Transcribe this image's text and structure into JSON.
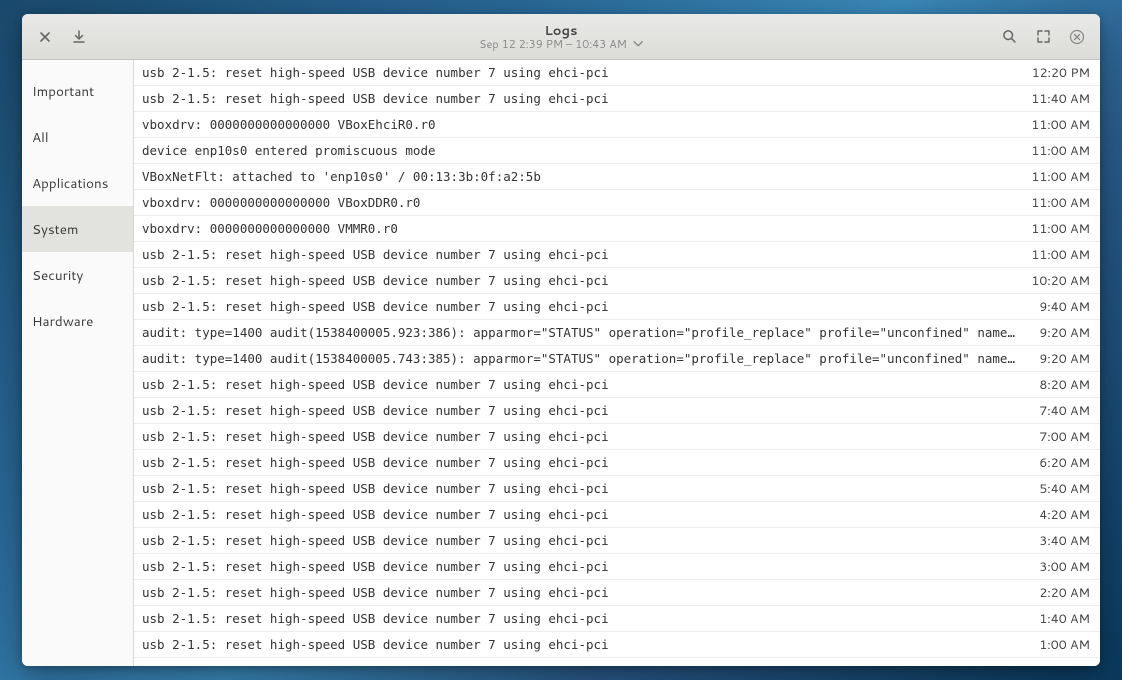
{
  "header": {
    "title": "Logs",
    "subtitle": "Sep 12  2:39 PM – 10:43 AM"
  },
  "sidebar": {
    "items": [
      {
        "label": "Important"
      },
      {
        "label": "All"
      },
      {
        "label": "Applications"
      },
      {
        "label": "System"
      },
      {
        "label": "Security"
      },
      {
        "label": "Hardware"
      }
    ],
    "active_index": 3
  },
  "logs": [
    {
      "msg": "usb 2-1.5: reset high-speed USB device number 7 using ehci-pci",
      "time": "12:20 PM"
    },
    {
      "msg": "usb 2-1.5: reset high-speed USB device number 7 using ehci-pci",
      "time": "11:40 AM"
    },
    {
      "msg": "vboxdrv: 0000000000000000 VBoxEhciR0.r0",
      "time": "11:00 AM"
    },
    {
      "msg": "device enp10s0 entered promiscuous mode",
      "time": "11:00 AM"
    },
    {
      "msg": "VBoxNetFlt: attached to 'enp10s0' / 00:13:3b:0f:a2:5b",
      "time": "11:00 AM"
    },
    {
      "msg": "vboxdrv: 0000000000000000 VBoxDDR0.r0",
      "time": "11:00 AM"
    },
    {
      "msg": "vboxdrv: 0000000000000000 VMMR0.r0",
      "time": "11:00 AM"
    },
    {
      "msg": "usb 2-1.5: reset high-speed USB device number 7 using ehci-pci",
      "time": "11:00 AM"
    },
    {
      "msg": "usb 2-1.5: reset high-speed USB device number 7 using ehci-pci",
      "time": "10:20 AM"
    },
    {
      "msg": "usb 2-1.5: reset high-speed USB device number 7 using ehci-pci",
      "time": "9:40 AM"
    },
    {
      "msg": "audit: type=1400 audit(1538400005.923:386): apparmor=\"STATUS\" operation=\"profile_replace\" profile=\"unconfined\" name=\"...\"",
      "time": "9:20 AM"
    },
    {
      "msg": "audit: type=1400 audit(1538400005.743:385): apparmor=\"STATUS\" operation=\"profile_replace\" profile=\"unconfined\" name=\"...\"",
      "time": "9:20 AM"
    },
    {
      "msg": "usb 2-1.5: reset high-speed USB device number 7 using ehci-pci",
      "time": "8:20 AM"
    },
    {
      "msg": "usb 2-1.5: reset high-speed USB device number 7 using ehci-pci",
      "time": "7:40 AM"
    },
    {
      "msg": "usb 2-1.5: reset high-speed USB device number 7 using ehci-pci",
      "time": "7:00 AM"
    },
    {
      "msg": "usb 2-1.5: reset high-speed USB device number 7 using ehci-pci",
      "time": "6:20 AM"
    },
    {
      "msg": "usb 2-1.5: reset high-speed USB device number 7 using ehci-pci",
      "time": "5:40 AM"
    },
    {
      "msg": "usb 2-1.5: reset high-speed USB device number 7 using ehci-pci",
      "time": "4:20 AM"
    },
    {
      "msg": "usb 2-1.5: reset high-speed USB device number 7 using ehci-pci",
      "time": "3:40 AM"
    },
    {
      "msg": "usb 2-1.5: reset high-speed USB device number 7 using ehci-pci",
      "time": "3:00 AM"
    },
    {
      "msg": "usb 2-1.5: reset high-speed USB device number 7 using ehci-pci",
      "time": "2:20 AM"
    },
    {
      "msg": "usb 2-1.5: reset high-speed USB device number 7 using ehci-pci",
      "time": "1:40 AM"
    },
    {
      "msg": "usb 2-1.5: reset high-speed USB device number 7 using ehci-pci",
      "time": "1:00 AM"
    }
  ]
}
